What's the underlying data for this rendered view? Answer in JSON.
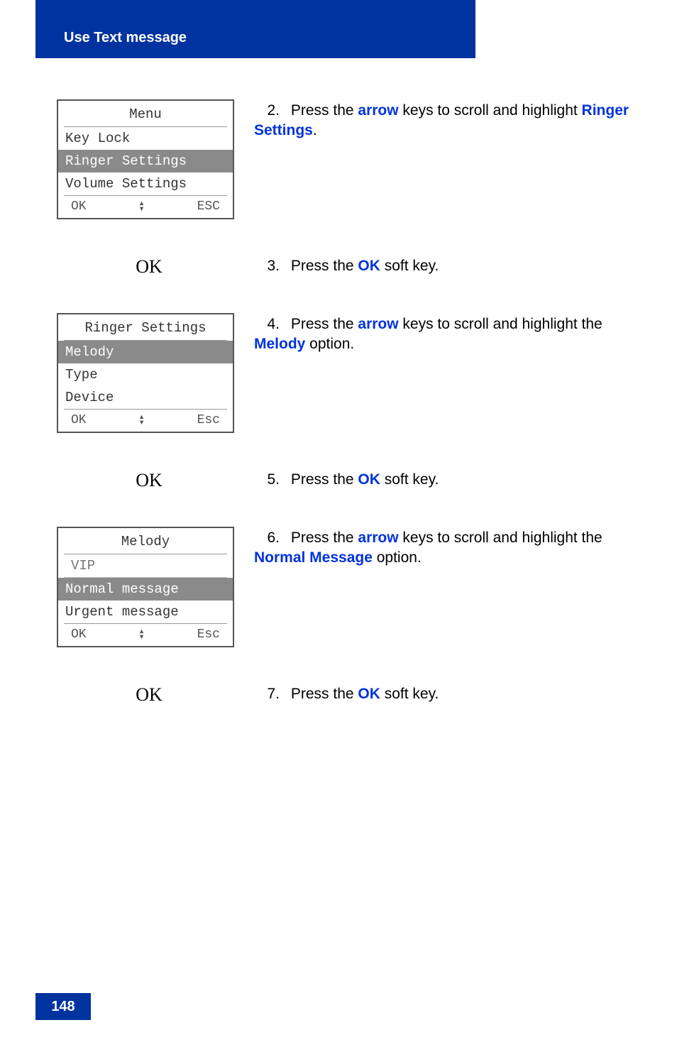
{
  "header": {
    "title": "Use Text message"
  },
  "page_number": "148",
  "screens": {
    "menu": {
      "title": "Menu",
      "items": [
        "Key Lock",
        "Ringer Settings",
        "Volume Settings"
      ],
      "selected": 1,
      "foot_left": "OK",
      "foot_right": "ESC"
    },
    "ringer": {
      "title": "Ringer Settings",
      "items": [
        "Melody",
        "Type",
        "Device"
      ],
      "selected": 0,
      "foot_left": "OK",
      "foot_right": "Esc"
    },
    "melody": {
      "title": "Melody",
      "vip": "VIP",
      "items": [
        "Normal message",
        "Urgent message"
      ],
      "selected": 0,
      "foot_left": "OK",
      "foot_right": "Esc"
    }
  },
  "ok_label": "OK",
  "steps": {
    "s2": {
      "num": "2.",
      "pre": "Press the ",
      "hl1": "arrow",
      "mid": " keys to scroll and highlight ",
      "hl2": "Ringer Settings",
      "post": "."
    },
    "s3": {
      "num": "3.",
      "pre": "Press the ",
      "hl1": "OK",
      "post": " soft key."
    },
    "s4": {
      "num": "4.",
      "pre": "Press the ",
      "hl1": "arrow",
      "mid": " keys to scroll and highlight the ",
      "hl2": "Melody",
      "post": " option."
    },
    "s5": {
      "num": "5.",
      "pre": "Press the ",
      "hl1": "OK",
      "post": " soft key."
    },
    "s6": {
      "num": "6.",
      "pre": "Press the ",
      "hl1": "arrow",
      "mid": " keys to scroll and highlight the ",
      "hl2": "Normal Message",
      "post": " option."
    },
    "s7": {
      "num": "7.",
      "pre": "Press the ",
      "hl1": "OK",
      "post": " soft key."
    }
  }
}
